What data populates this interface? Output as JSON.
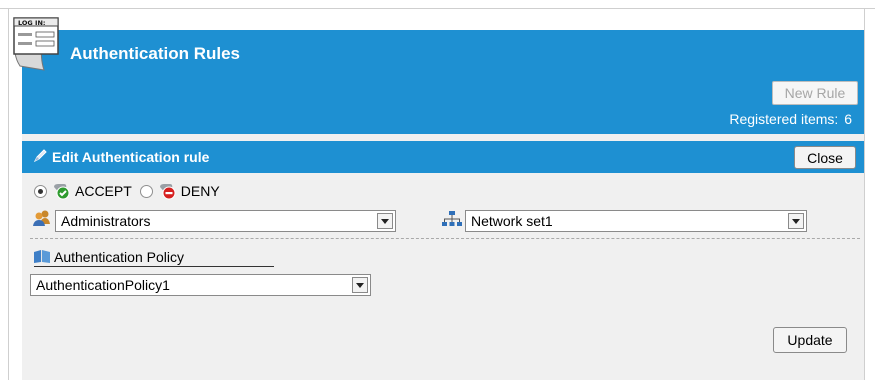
{
  "header": {
    "logo_text": "LOG IN:",
    "title": "Authentication Rules",
    "new_rule_label": "New Rule",
    "registered_label": "Registered items:",
    "registered_count": "6"
  },
  "edit_panel": {
    "title": "Edit Authentication rule",
    "close_label": "Close",
    "rule_options": [
      {
        "label": "ACCEPT",
        "selected": true
      },
      {
        "label": "DENY",
        "selected": false
      }
    ],
    "user_group_select": {
      "value": "Administrators"
    },
    "network_select": {
      "value": "Network set1"
    },
    "policy_label": "Authentication Policy",
    "policy_select": {
      "value": "AuthenticationPolicy1"
    },
    "update_label": "Update"
  },
  "colors": {
    "header_blue": "#1e90d2",
    "panel_gray": "#f0f0f0"
  },
  "icons": [
    "login-logo-icon",
    "pencil-icon",
    "accept-icon",
    "deny-icon",
    "users-icon",
    "network-icon",
    "policy-icon"
  ]
}
